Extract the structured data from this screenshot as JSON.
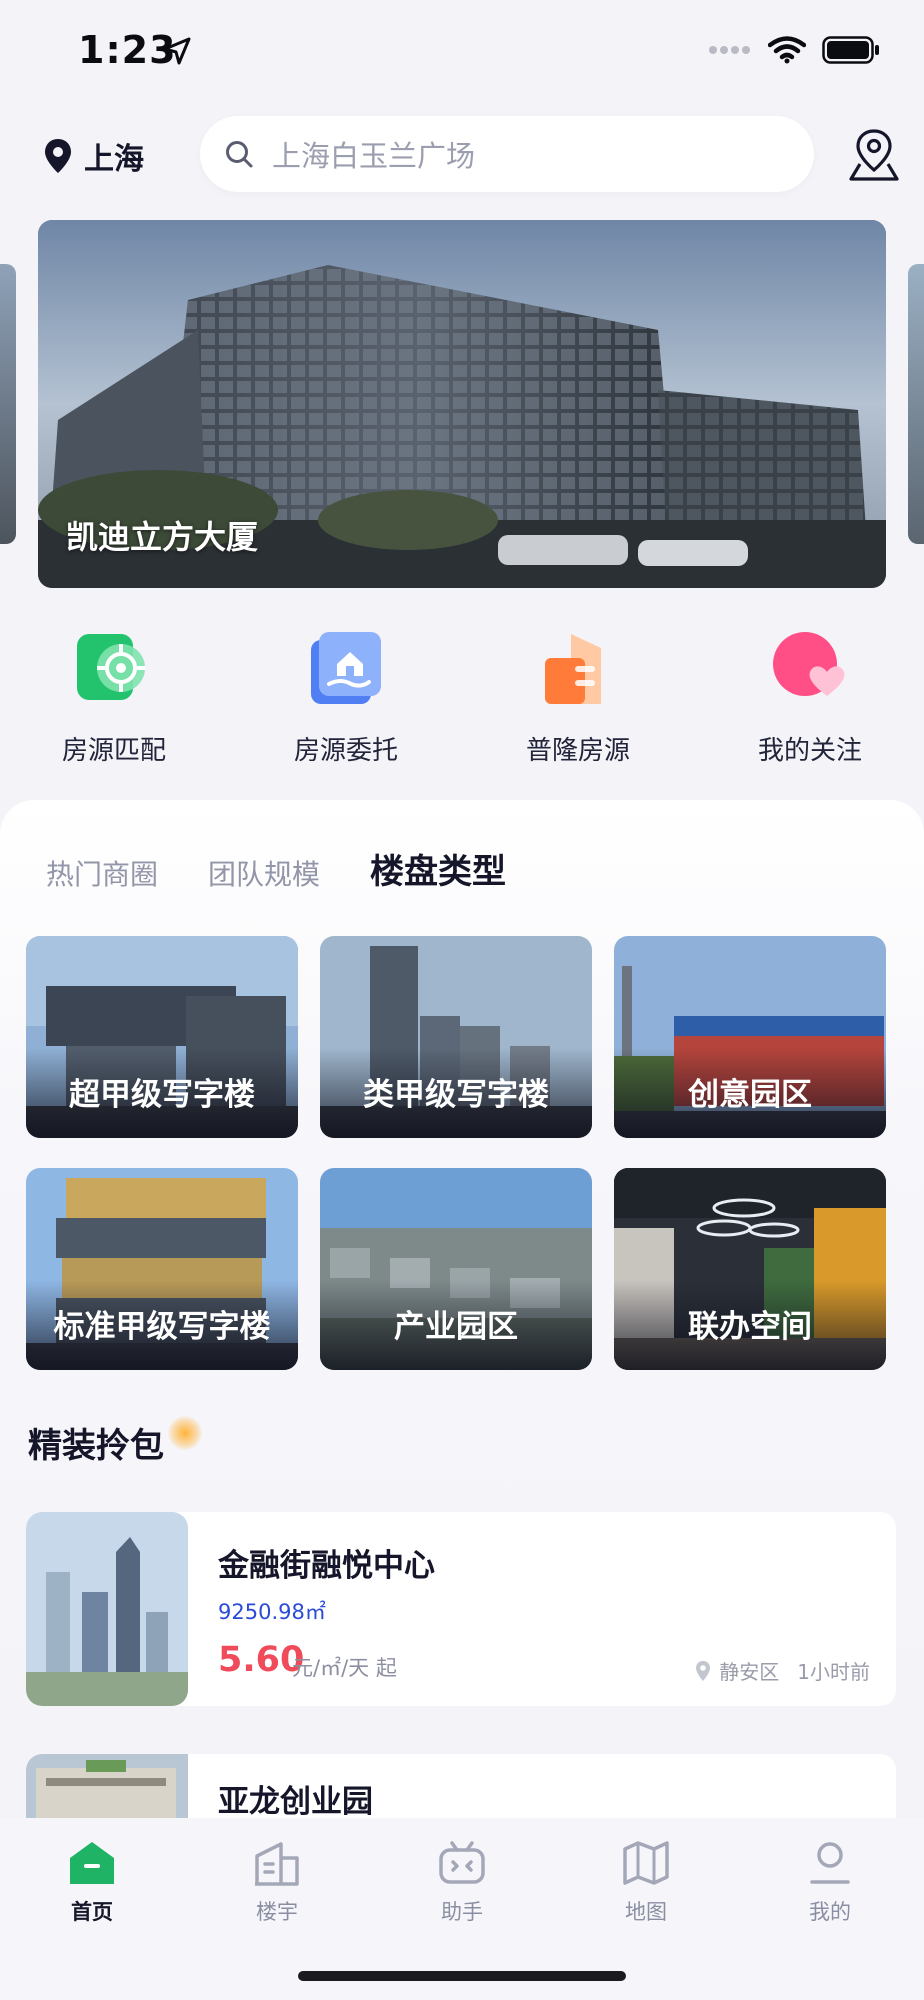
{
  "status_bar": {
    "time": "1:23"
  },
  "header": {
    "city": "上海",
    "search_placeholder": "上海白玉兰广场"
  },
  "banner": {
    "title": "凯迪立方大厦"
  },
  "quick_actions": [
    {
      "label": "房源匹配",
      "icon": "target-icon"
    },
    {
      "label": "房源委托",
      "icon": "house-hand-icon"
    },
    {
      "label": "普隆房源",
      "icon": "building-icon"
    },
    {
      "label": "我的关注",
      "icon": "heart-icon"
    }
  ],
  "category_tabs": [
    "热门商圈",
    "团队规模",
    "楼盘类型"
  ],
  "active_category_tab": "楼盘类型",
  "building_types": [
    {
      "label": "超甲级写字楼"
    },
    {
      "label": "类甲级写字楼"
    },
    {
      "label": "创意园区"
    },
    {
      "label": "标准甲级写字楼"
    },
    {
      "label": "产业园区"
    },
    {
      "label": "联办空间"
    }
  ],
  "section": {
    "title": "精装拎包"
  },
  "listings": [
    {
      "name": "金融街融悦中心",
      "area": "9250.98㎡",
      "price": "5.60",
      "unit": "元/㎡/天 起",
      "district": "静安区",
      "time": "1小时前"
    },
    {
      "name": "亚龙创业园"
    }
  ],
  "tab_bar": [
    {
      "label": "首页",
      "active": true
    },
    {
      "label": "楼宇"
    },
    {
      "label": "助手"
    },
    {
      "label": "地图"
    },
    {
      "label": "我的"
    }
  ],
  "colors": {
    "accent_green": "#1fb366",
    "price_red": "#ef4b5a",
    "area_blue": "#2a4bd7"
  }
}
